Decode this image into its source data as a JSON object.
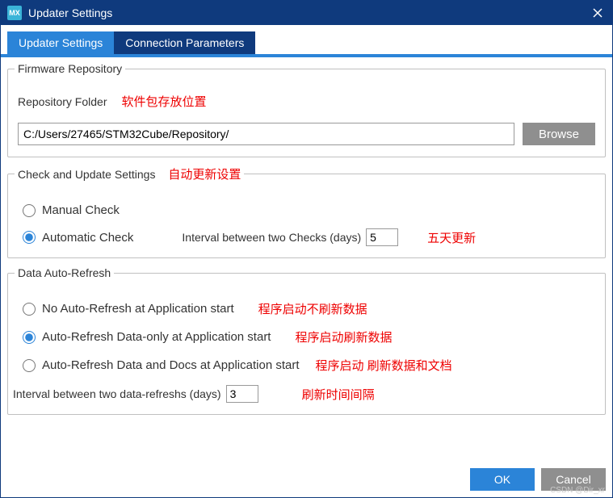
{
  "titlebar": {
    "icon_text": "MX",
    "title": "Updater Settings"
  },
  "tabs": {
    "updater": "Updater Settings",
    "connection": "Connection Parameters"
  },
  "firmware": {
    "legend": "Firmware Repository",
    "repo_label": "Repository Folder",
    "repo_anno": "软件包存放位置",
    "repo_value": "C:/Users/27465/STM32Cube/Repository/",
    "browse": "Browse"
  },
  "check": {
    "legend": "Check and Update Settings",
    "legend_anno": "自动更新设置",
    "manual": "Manual Check",
    "automatic": "Automatic Check",
    "interval_label": "Interval between two Checks (days)",
    "interval_value": "5",
    "interval_anno": "五天更新"
  },
  "refresh": {
    "legend": "Data Auto-Refresh",
    "opt_none": "No Auto-Refresh at Application start",
    "opt_none_anno": "程序启动不刷新数据",
    "opt_data": "Auto-Refresh Data-only at Application start",
    "opt_data_anno": "程序启动刷新数据",
    "opt_docs": "Auto-Refresh Data and Docs at Application start",
    "opt_docs_anno": "程序启动 刷新数据和文档",
    "interval_label": "Interval between two data-refreshs (days)",
    "interval_value": "3",
    "interval_anno": "刷新时间间隔"
  },
  "footer": {
    "ok": "OK",
    "cancel": "Cancel"
  },
  "watermark": "CSDN @Dir_xr"
}
